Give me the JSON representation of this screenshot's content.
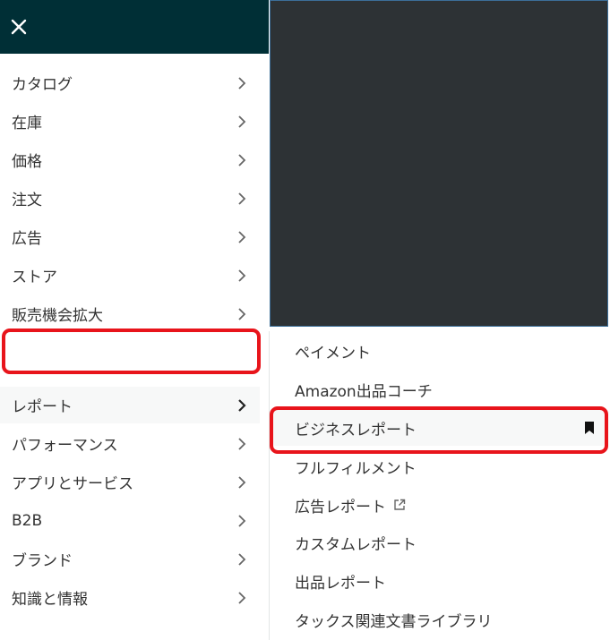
{
  "nav": {
    "items": [
      {
        "label": "カタログ"
      },
      {
        "label": "在庫"
      },
      {
        "label": "価格"
      },
      {
        "label": "注文"
      },
      {
        "label": "広告"
      },
      {
        "label": "ストア"
      },
      {
        "label": "販売機会拡大"
      },
      {
        "label": "レポート",
        "active": true
      },
      {
        "label": "パフォーマンス"
      },
      {
        "label": "アプリとサービス"
      },
      {
        "label": "B2B"
      },
      {
        "label": "ブランド"
      },
      {
        "label": "知識と情報"
      }
    ]
  },
  "submenu": {
    "items": [
      {
        "label": "ペイメント"
      },
      {
        "label": "Amazon出品コーチ"
      },
      {
        "label": "ビジネスレポート",
        "bookmarked": true
      },
      {
        "label": "フルフィルメント"
      },
      {
        "label": "広告レポート",
        "external": true
      },
      {
        "label": "カスタムレポート"
      },
      {
        "label": "出品レポート"
      },
      {
        "label": "タックス関連文書ライブラリ"
      }
    ]
  },
  "colors": {
    "header_bg": "#002f36",
    "highlight_border": "#e8141b",
    "overlay": "#2d3235"
  }
}
